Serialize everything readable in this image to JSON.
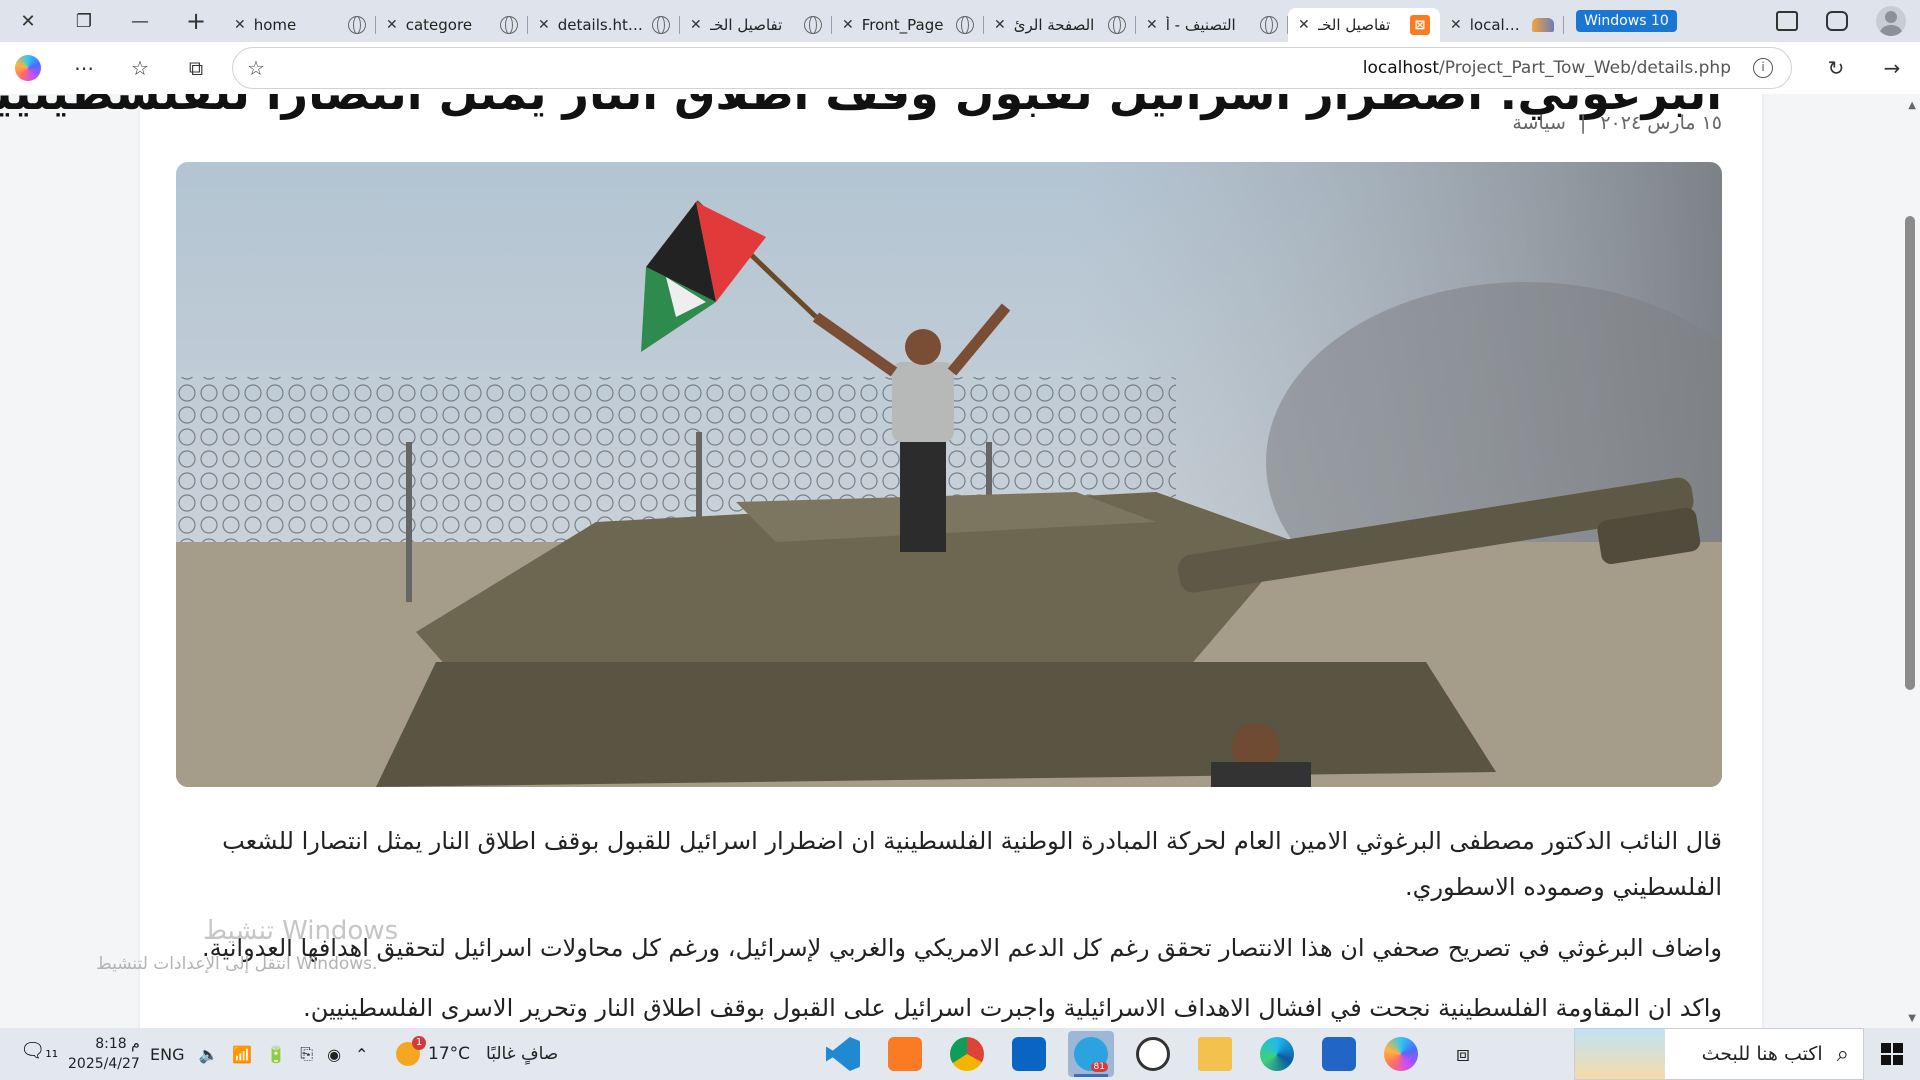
{
  "browser": {
    "tabs": [
      {
        "title": "home",
        "icon": "globe-icon"
      },
      {
        "title": "categore",
        "icon": "globe-icon"
      },
      {
        "title": "details.html",
        "icon": "globe-icon"
      },
      {
        "title": "تفاصيل الخـ",
        "icon": "globe-icon"
      },
      {
        "title": "Front_Page",
        "icon": "globe-icon"
      },
      {
        "title": "الصفحة الرئ",
        "icon": "globe-icon"
      },
      {
        "title": "التصنيف - أ",
        "icon": "globe-icon"
      },
      {
        "title": "تفاصيل الخـ",
        "icon": "xampp-icon",
        "active": true
      },
      {
        "title": "localhost / ",
        "icon": "phpmyadmin-icon"
      }
    ],
    "windows_badge": "Windows 10",
    "address": {
      "host": "localhost",
      "path": "/Project_Part_Tow_Web/details.php"
    }
  },
  "article": {
    "headline": "البرغوثي: اضطرار اسرائيل لقبول وقف اطلاق النار يمثل انتصارا للفلسطينيين",
    "date": "١٥ مارس ٢٠٢٤",
    "separator": "|",
    "category": "سياسة",
    "paragraphs": [
      "قال النائب الدكتور مصطفى البرغوثي الامين العام لحركة المبادرة الوطنية الفلسطينية ان اضطرار اسرائيل للقبول بوقف اطلاق النار يمثل انتصارا للشعب الفلسطيني وصموده الاسطوري.",
      "واضاف البرغوثي في تصريح صحفي ان هذا الانتصار تحقق رغم كل الدعم الامريكي والغربي لإسرائيل، ورغم كل محاولات اسرائيل لتحقيق اهدافها العدوانية.",
      "واكد ان المقاومة الفلسطينية نجحت في افشال الاهداف الاسرائيلية واجبرت اسرائيل على القبول بوقف اطلاق النار وتحرير الاسرى الفلسطينيين."
    ]
  },
  "watermark": {
    "title": "تنشيط Windows",
    "subtitle": "انتقل إلى الإعدادات لتنشيط Windows."
  },
  "taskbar": {
    "search_placeholder": "اكتب هنا للبحث",
    "weather_temp": "17°C",
    "weather_text": "صافٍ غالبًا",
    "weather_badge": "1",
    "language": "ENG",
    "time": "8:18 م",
    "date": "2025/4/27",
    "telegram_badge": "81",
    "notification_count": "11",
    "apps": [
      "vscode-icon",
      "xampp-icon",
      "chrome-icon",
      "outlook-icon",
      "telegram-icon",
      "whatsapp-icon",
      "file-explorer-icon",
      "edge-icon",
      "store-icon",
      "copilot-icon"
    ]
  },
  "colors": {
    "accent": "#1976d2",
    "xampp": "#fb7a24",
    "taskbar": "#e3e8ef"
  }
}
